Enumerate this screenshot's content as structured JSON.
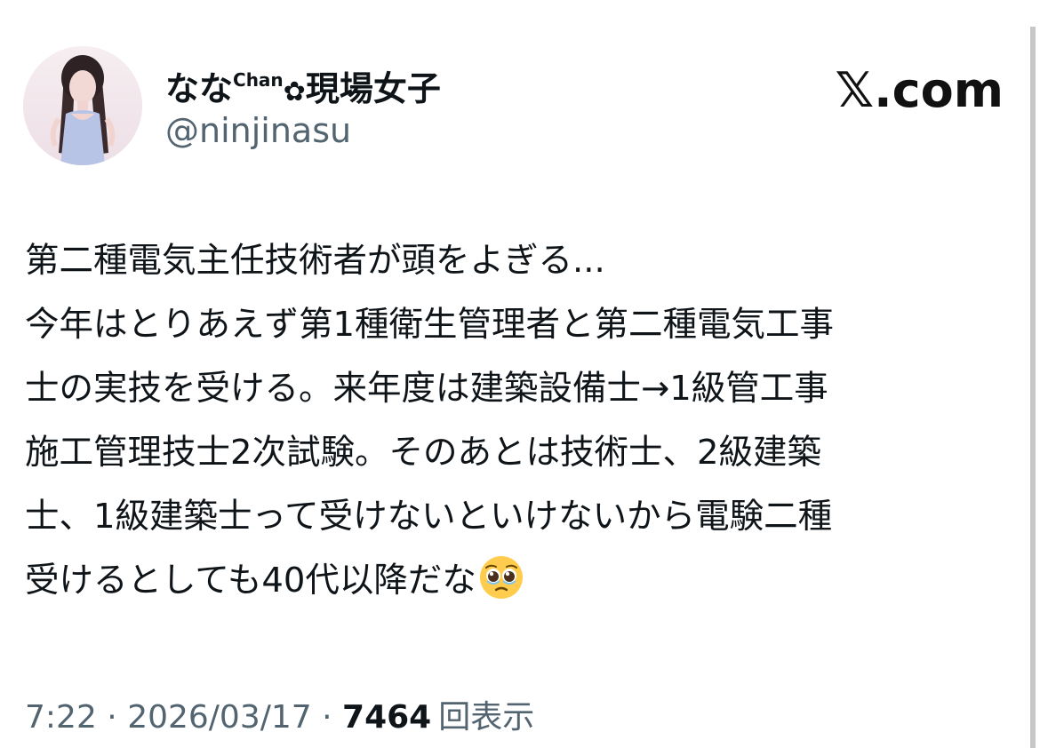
{
  "author": {
    "display_name": "なな",
    "name_superscript": "Chan",
    "name_flower": "✿",
    "name_suffix": "現場女子",
    "handle": "@ninjinasu",
    "avatar_icon": "profile-photo"
  },
  "site": {
    "logo": "𝕏.com"
  },
  "tweet": {
    "lines": [
      "第二種電気主任技術者が頭をよぎる...",
      "今年はとりあえず第1種衛生管理者と第二種電気工事",
      "士の実技を受ける。来年度は建築設備士→1級管工事",
      "施工管理技士2次試験。そのあとは技術士、2級建築",
      "士、1級建築士って受けないといけないから電験二種",
      "受けるとしても40代以降だな"
    ],
    "emoji": "pleading-face-emoji"
  },
  "meta": {
    "time": "7:22",
    "separator": " · ",
    "date": "2026/03/17",
    "views_count": "7464",
    "views_label": "回表示"
  },
  "colors": {
    "text_primary": "#0f1419",
    "text_secondary": "#536471",
    "background": "#ffffff"
  }
}
